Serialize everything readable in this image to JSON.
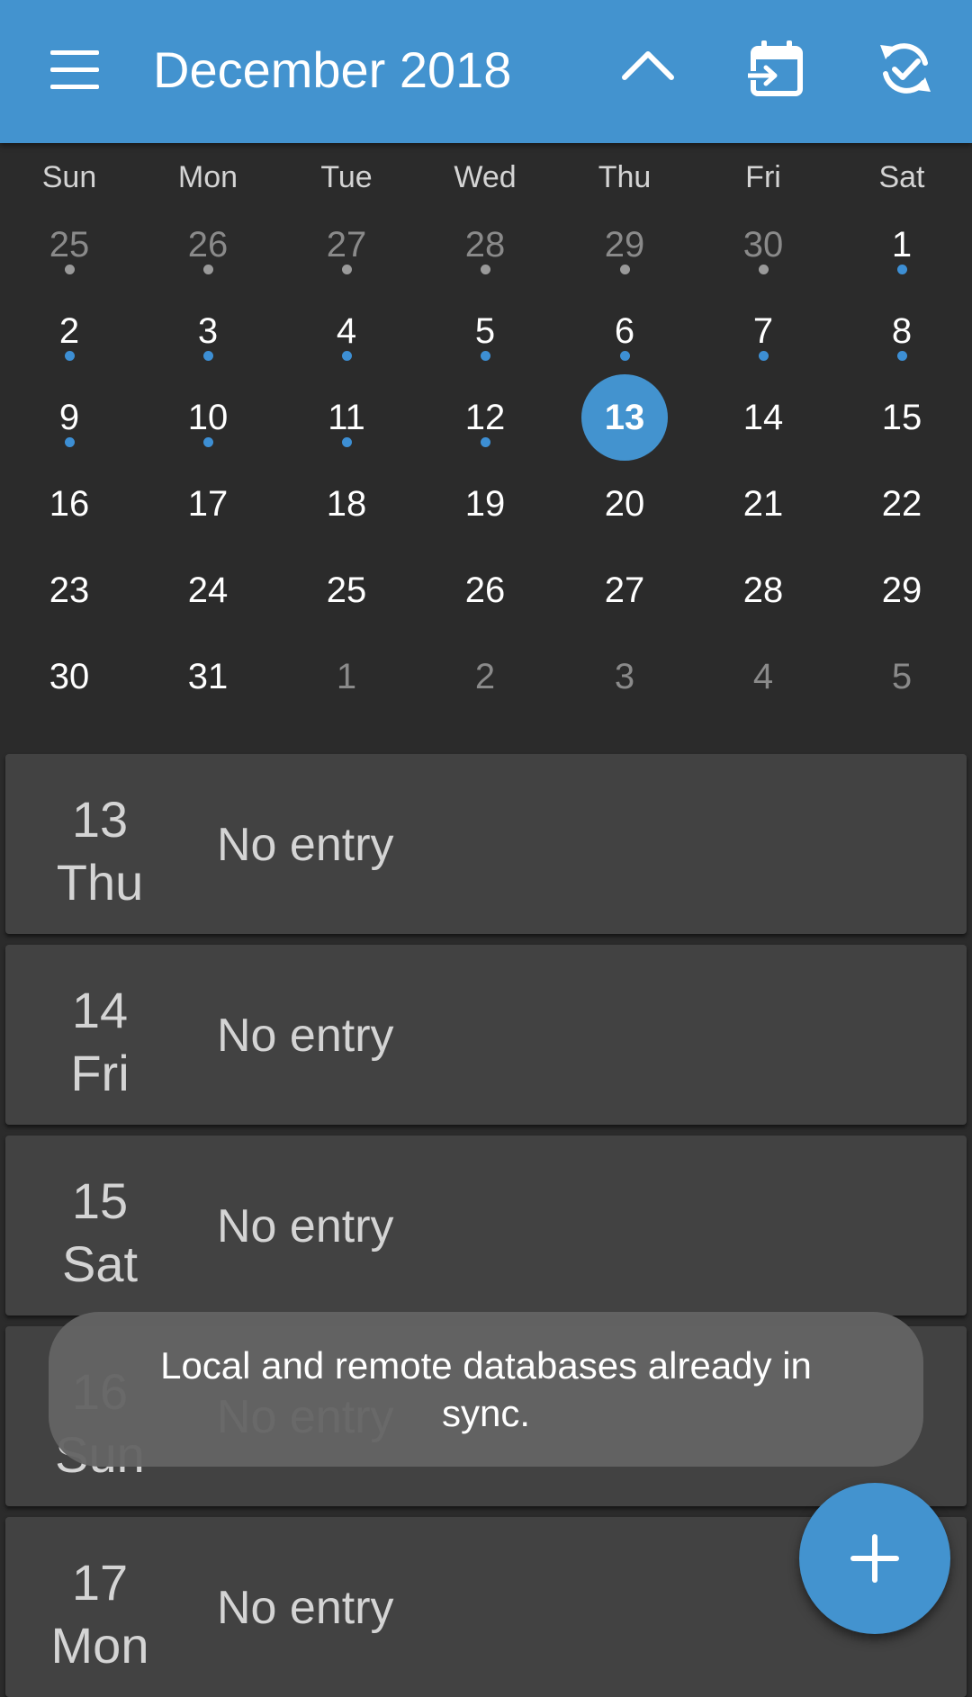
{
  "appbar": {
    "title": "December 2018",
    "icons": [
      "menu-icon",
      "chevron-up-icon",
      "calendar-import-icon",
      "sync-check-icon"
    ]
  },
  "colors": {
    "accent": "#4393cf",
    "background": "#2b2b2b",
    "card": "#424242",
    "event_dot": "#3d8fd4"
  },
  "weekdays": [
    "Sun",
    "Mon",
    "Tue",
    "Wed",
    "Thu",
    "Fri",
    "Sat"
  ],
  "calendar": {
    "weeks": [
      [
        {
          "d": "25",
          "month": "other",
          "dot": "gray"
        },
        {
          "d": "26",
          "month": "other",
          "dot": "gray"
        },
        {
          "d": "27",
          "month": "other",
          "dot": "gray"
        },
        {
          "d": "28",
          "month": "other",
          "dot": "gray"
        },
        {
          "d": "29",
          "month": "other",
          "dot": "gray"
        },
        {
          "d": "30",
          "month": "other",
          "dot": "gray"
        },
        {
          "d": "1",
          "month": "current",
          "dot": "blue"
        }
      ],
      [
        {
          "d": "2",
          "month": "current",
          "dot": "blue"
        },
        {
          "d": "3",
          "month": "current",
          "dot": "blue"
        },
        {
          "d": "4",
          "month": "current",
          "dot": "blue"
        },
        {
          "d": "5",
          "month": "current",
          "dot": "blue"
        },
        {
          "d": "6",
          "month": "current",
          "dot": "blue"
        },
        {
          "d": "7",
          "month": "current",
          "dot": "blue"
        },
        {
          "d": "8",
          "month": "current",
          "dot": "blue"
        }
      ],
      [
        {
          "d": "9",
          "month": "current",
          "dot": "blue"
        },
        {
          "d": "10",
          "month": "current",
          "dot": "blue"
        },
        {
          "d": "11",
          "month": "current",
          "dot": "blue"
        },
        {
          "d": "12",
          "month": "current",
          "dot": "blue"
        },
        {
          "d": "13",
          "month": "current",
          "selected": true
        },
        {
          "d": "14",
          "month": "current"
        },
        {
          "d": "15",
          "month": "current"
        }
      ],
      [
        {
          "d": "16",
          "month": "current"
        },
        {
          "d": "17",
          "month": "current"
        },
        {
          "d": "18",
          "month": "current"
        },
        {
          "d": "19",
          "month": "current"
        },
        {
          "d": "20",
          "month": "current"
        },
        {
          "d": "21",
          "month": "current"
        },
        {
          "d": "22",
          "month": "current"
        }
      ],
      [
        {
          "d": "23",
          "month": "current"
        },
        {
          "d": "24",
          "month": "current"
        },
        {
          "d": "25",
          "month": "current"
        },
        {
          "d": "26",
          "month": "current"
        },
        {
          "d": "27",
          "month": "current"
        },
        {
          "d": "28",
          "month": "current"
        },
        {
          "d": "29",
          "month": "current"
        }
      ],
      [
        {
          "d": "30",
          "month": "current"
        },
        {
          "d": "31",
          "month": "current"
        },
        {
          "d": "1",
          "month": "other"
        },
        {
          "d": "2",
          "month": "other"
        },
        {
          "d": "3",
          "month": "other"
        },
        {
          "d": "4",
          "month": "other"
        },
        {
          "d": "5",
          "month": "other"
        }
      ]
    ]
  },
  "entries": [
    {
      "day": "13",
      "weekday": "Thu",
      "text": "No entry"
    },
    {
      "day": "14",
      "weekday": "Fri",
      "text": "No entry"
    },
    {
      "day": "15",
      "weekday": "Sat",
      "text": "No entry"
    },
    {
      "day": "16",
      "weekday": "Sun",
      "text": "No entry"
    },
    {
      "day": "17",
      "weekday": "Mon",
      "text": "No entry"
    }
  ],
  "toast": {
    "message": "Local and remote databases already in sync."
  },
  "fab": {
    "icon": "plus-icon"
  }
}
